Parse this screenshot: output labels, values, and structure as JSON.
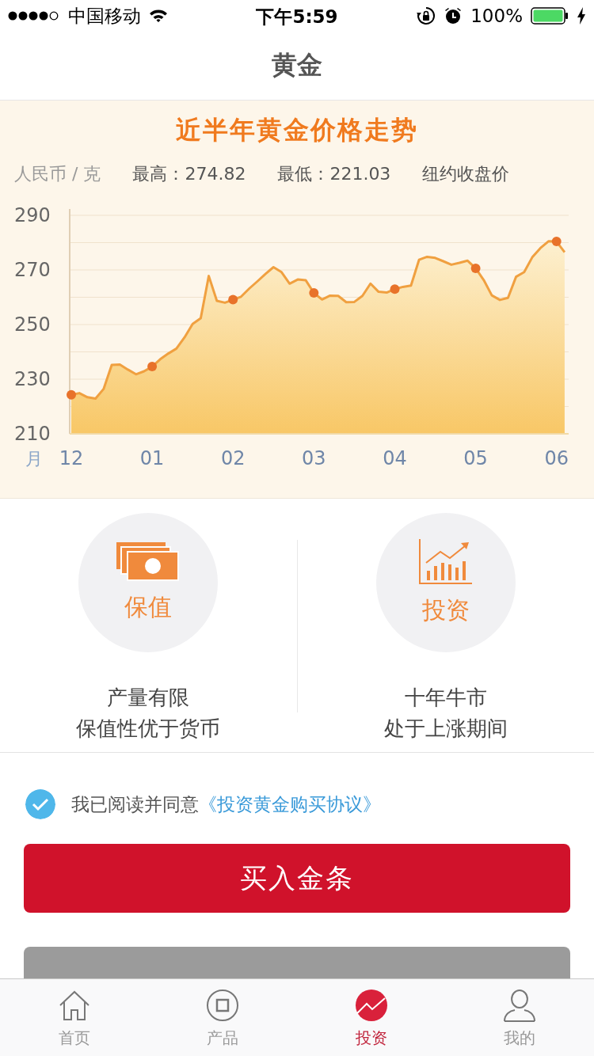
{
  "status_bar": {
    "carrier": "中国移动",
    "time": "下午5:59",
    "battery": "100%"
  },
  "nav": {
    "title": "黄金"
  },
  "chart_panel": {
    "unit": "人民币 / 克",
    "high": "最高：274.82",
    "low": "最低：221.03",
    "note": "纽约收盘价",
    "chart_data": {
      "type": "area",
      "title": "近半年黄金价格走势",
      "xlabel": "月",
      "categories": [
        "12",
        null,
        null,
        null,
        null,
        null,
        null,
        null,
        null,
        null,
        "01",
        null,
        null,
        null,
        null,
        null,
        null,
        null,
        null,
        null,
        "02",
        null,
        null,
        null,
        null,
        null,
        null,
        null,
        null,
        null,
        "03",
        null,
        null,
        null,
        null,
        null,
        null,
        null,
        null,
        null,
        "04",
        null,
        null,
        null,
        null,
        null,
        null,
        null,
        null,
        null,
        "05",
        null,
        null,
        null,
        null,
        null,
        null,
        null,
        null,
        null,
        "06",
        null
      ],
      "series": [
        {
          "color": "#f0a040",
          "values": [
            224.3,
            224.9,
            223.4,
            222.9,
            226.4,
            235.2,
            235.4,
            233.5,
            231.8,
            232.9,
            234.6,
            237.3,
            239.4,
            241.2,
            245.3,
            250.2,
            252.3,
            267.8,
            258.7,
            258,
            259.1,
            260.2,
            263.2,
            265.8,
            268.5,
            271,
            269.2,
            265,
            266.5,
            266.2,
            261.6,
            259.2,
            260.6,
            260.5,
            258.2,
            258.3,
            260.5,
            265,
            262,
            261.7,
            263,
            263.8,
            264.3,
            273.7,
            274.8,
            274.4,
            273.2,
            271.9,
            272.6,
            273.4,
            270.6,
            266.3,
            260.7,
            259,
            259.8,
            267.5,
            269.2,
            274.6,
            278,
            280.5,
            280.4,
            276.5
          ]
        }
      ],
      "ylim": [
        210,
        290
      ],
      "yticks": [
        210,
        230,
        250,
        270,
        290
      ],
      "grid": true
    }
  },
  "features": [
    {
      "title": "保值",
      "lines": [
        "产量有限",
        "保值性优于货币"
      ]
    },
    {
      "title": "投资",
      "lines": [
        "十年牛市",
        "处于上涨期间"
      ]
    }
  ],
  "agreement": {
    "checked": true,
    "text": "我已阅读并同意",
    "link": "《投资黄金购买协议》"
  },
  "buttons": [
    {
      "label": "买入金条",
      "disabled": false
    },
    {
      "disabled": true
    }
  ],
  "tabs": [
    {
      "label": "首页",
      "selected": false
    },
    {
      "label": "产品",
      "selected": false
    },
    {
      "label": "投资",
      "selected": true
    },
    {
      "label": "我的",
      "selected": false
    }
  ]
}
